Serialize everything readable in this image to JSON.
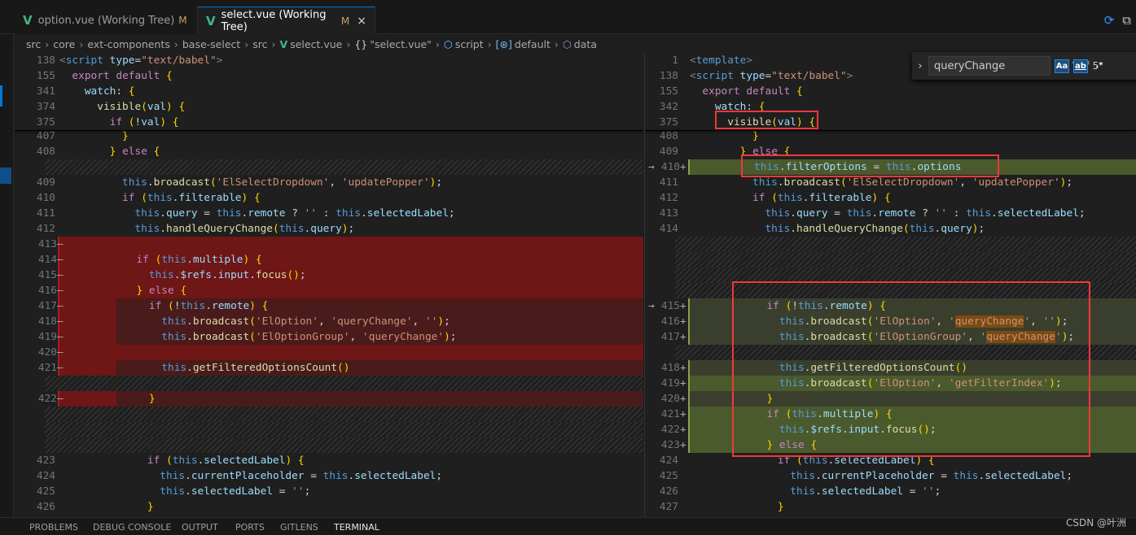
{
  "tabs": [
    {
      "label": "option.vue (Working Tree)",
      "status": "M",
      "active": false
    },
    {
      "label": "select.vue (Working Tree)",
      "status": "M",
      "active": true,
      "close": "×"
    }
  ],
  "breadcrumb": [
    {
      "label": "src"
    },
    {
      "label": "core"
    },
    {
      "label": "ext-components"
    },
    {
      "label": "base-select"
    },
    {
      "label": "src"
    },
    {
      "label": "select.vue",
      "icon": "vue-icon"
    },
    {
      "label": "\"select.vue\"",
      "icon": "braces-icon",
      "glyph": "{}"
    },
    {
      "label": "script",
      "icon": "cube-icon",
      "glyph": "⬡"
    },
    {
      "label": "default",
      "icon": "variable-icon",
      "glyph": "[⊛]"
    },
    {
      "label": "data",
      "icon": "package-icon",
      "glyph": "⬡"
    }
  ],
  "find": {
    "query": "queryChange",
    "match_case": "Aa",
    "whole_word": "ab",
    "regex": ".*",
    "count": "? of 5"
  },
  "colors": {
    "removed": "#6f1616",
    "added": "#4b5a2c",
    "accent": "#0078d4",
    "annotation": "#f0383b"
  },
  "left": {
    "sticky": [
      {
        "n": "138",
        "text": "<script type=\"text/babel\">"
      },
      {
        "n": "155",
        "text": "  export default {"
      },
      {
        "n": "341",
        "text": "    watch: {"
      },
      {
        "n": "374",
        "text": "      visible(val) {"
      },
      {
        "n": "375",
        "text": "        if (!val) {"
      }
    ],
    "rows": [
      {
        "n": "407",
        "text": "          }"
      },
      {
        "n": "408",
        "text": "        } else {"
      },
      {
        "type": "hatch"
      },
      {
        "n": "409",
        "text": "          this.broadcast('ElSelectDropdown', 'updatePopper');"
      },
      {
        "n": "410",
        "text": "          if (this.filterable) {"
      },
      {
        "n": "411",
        "text": "            this.query = this.remote ? '' : this.selectedLabel;"
      },
      {
        "n": "412",
        "text": "            this.handleQueryChange(this.query);"
      },
      {
        "n": "413",
        "m": "—",
        "type": "r-strong",
        "text": ""
      },
      {
        "n": "414",
        "m": "—",
        "type": "r-strong",
        "text": "            if (this.multiple) {"
      },
      {
        "n": "415",
        "m": "—",
        "type": "r-strong",
        "text": "              this.$refs.input.focus();"
      },
      {
        "n": "416",
        "m": "—",
        "type": "r-strong",
        "text": "            } else {"
      },
      {
        "n": "417",
        "m": "—",
        "type": "r-light",
        "text": "              if (!this.remote) {"
      },
      {
        "n": "418",
        "m": "—",
        "type": "r-light",
        "text": "                this.broadcast('ElOption', 'queryChange', '');"
      },
      {
        "n": "419",
        "m": "—",
        "type": "r-light",
        "text": "                this.broadcast('ElOptionGroup', 'queryChange');"
      },
      {
        "n": "420",
        "m": "—",
        "type": "r-strong",
        "text": ""
      },
      {
        "n": "421",
        "m": "—",
        "type": "r-light",
        "text": "                this.getFilteredOptionsCount()"
      },
      {
        "type": "hatch"
      },
      {
        "n": "422",
        "m": "—",
        "type": "r-light",
        "text": "              }"
      },
      {
        "type": "hatch"
      },
      {
        "type": "hatch"
      },
      {
        "type": "hatch"
      },
      {
        "n": "423",
        "text": "              if (this.selectedLabel) {"
      },
      {
        "n": "424",
        "text": "                this.currentPlaceholder = this.selectedLabel;"
      },
      {
        "n": "425",
        "text": "                this.selectedLabel = '';"
      },
      {
        "n": "426",
        "text": "              }"
      }
    ]
  },
  "right": {
    "sticky": [
      {
        "n": "1",
        "text": "<template>"
      },
      {
        "n": "138",
        "text": "<script type=\"text/babel\">"
      },
      {
        "n": "155",
        "text": "  export default {"
      },
      {
        "n": "342",
        "text": "    watch: {"
      },
      {
        "n": "375",
        "text": "      visible(val) {"
      }
    ],
    "rows": [
      {
        "n": "408",
        "text": "          }"
      },
      {
        "n": "409",
        "text": "        } else {"
      },
      {
        "n": "410",
        "m": "+",
        "arrow": "→",
        "type": "a-strong",
        "text": "          this.filterOptions = this.options"
      },
      {
        "n": "411",
        "text": "          this.broadcast('ElSelectDropdown', 'updatePopper');"
      },
      {
        "n": "412",
        "text": "          if (this.filterable) {"
      },
      {
        "n": "413",
        "text": "            this.query = this.remote ? '' : this.selectedLabel;"
      },
      {
        "n": "414",
        "text": "            this.handleQueryChange(this.query);"
      },
      {
        "type": "hatch"
      },
      {
        "type": "hatch"
      },
      {
        "type": "hatch"
      },
      {
        "type": "hatch"
      },
      {
        "n": "415",
        "m": "+",
        "arrow": "→",
        "type": "a-light",
        "text": "            if (!this.remote) {"
      },
      {
        "n": "416",
        "m": "+",
        "type": "a-light",
        "text": "              this.broadcast('ElOption', 'queryChange', '');"
      },
      {
        "n": "417",
        "m": "+",
        "type": "a-light",
        "text": "              this.broadcast('ElOptionGroup', 'queryChange');"
      },
      {
        "type": "hatch"
      },
      {
        "n": "418",
        "m": "+",
        "type": "a-light",
        "text": "              this.getFilteredOptionsCount()"
      },
      {
        "n": "419",
        "m": "+",
        "type": "a-strong",
        "text": "              this.broadcast('ElOption', 'getFilterIndex');"
      },
      {
        "n": "420",
        "m": "+",
        "type": "a-light",
        "text": "            }"
      },
      {
        "n": "421",
        "m": "+",
        "type": "a-strong",
        "text": "            if (this.multiple) {"
      },
      {
        "n": "422",
        "m": "+",
        "type": "a-strong",
        "text": "              this.$refs.input.focus();"
      },
      {
        "n": "423",
        "m": "+",
        "type": "a-strong",
        "text": "            } else {"
      },
      {
        "n": "424",
        "text": "              if (this.selectedLabel) {"
      },
      {
        "n": "425",
        "text": "                this.currentPlaceholder = this.selectedLabel;"
      },
      {
        "n": "426",
        "text": "                this.selectedLabel = '';"
      },
      {
        "n": "427",
        "text": "              }"
      }
    ]
  },
  "panel_tabs": [
    "PROBLEMS",
    "DEBUG CONSOLE",
    "OUTPUT",
    "PORTS",
    "GITLENS",
    "TERMINAL"
  ],
  "watermark": "CSDN @叶洲"
}
